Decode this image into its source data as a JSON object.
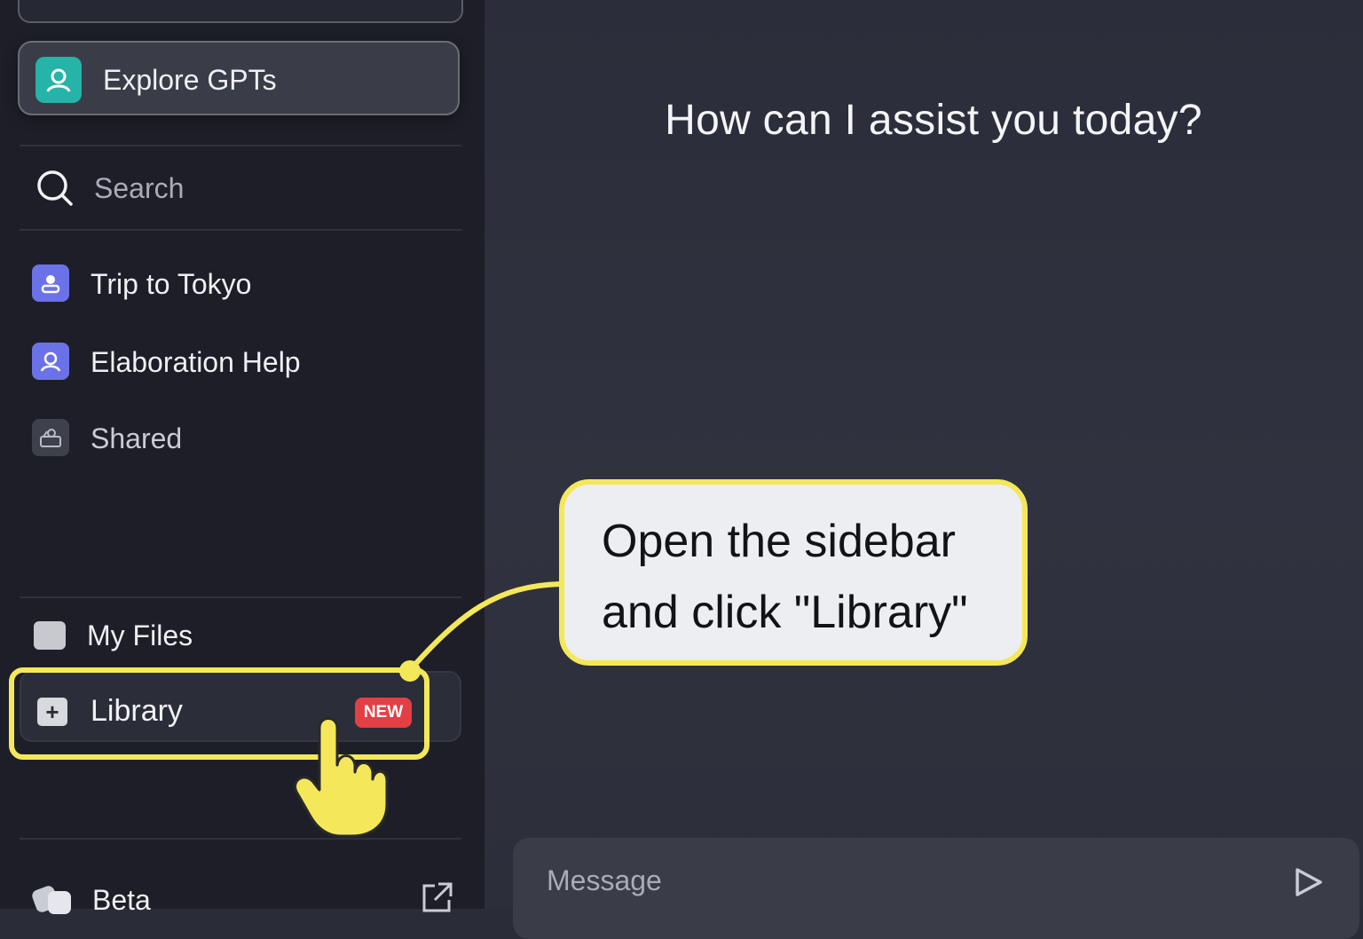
{
  "sidebar": {
    "explore_label": "Explore GPTs",
    "search_label": "Search",
    "items": [
      {
        "label": "Trip to Tokyo"
      },
      {
        "label": "Elaboration Help"
      },
      {
        "label": "Shared"
      }
    ],
    "my_files_label": "My Files",
    "library_label": "Library",
    "library_badge": "NEW",
    "beta_label": "Beta"
  },
  "main": {
    "greeting": "How can I assist you today?",
    "message_placeholder": "Message"
  },
  "callout": {
    "line1": "Open the sidebar",
    "line2": "and click \"Library\""
  },
  "colors": {
    "highlight": "#f4e85a",
    "badge": "#e33f45",
    "explore_icon": "#26b3a8",
    "chat_icon": "#6b72e8"
  }
}
